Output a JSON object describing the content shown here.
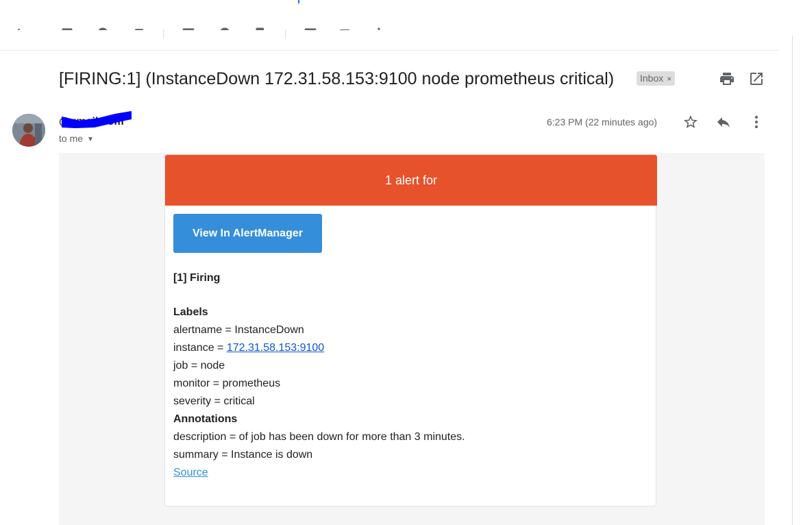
{
  "toolbar": {
    "icons": [
      "back-icon",
      "archive-icon",
      "report-spam-icon",
      "delete-icon",
      "mark-unread-icon",
      "snooze-icon",
      "add-task-icon",
      "move-to-icon",
      "labels-icon",
      "more-icon"
    ]
  },
  "subject": "[FIRING:1] (InstanceDown 172.31.58.153:9100 node prometheus critical)",
  "label_badge": {
    "text": "Inbox",
    "close": "×"
  },
  "header_icons": [
    "print-icon",
    "open-in-new-window-icon"
  ],
  "message": {
    "sender_email": "@gmail.com",
    "recipient": "to me",
    "timestamp": "6:23 PM (22 minutes ago)",
    "action_icons": [
      "star-icon",
      "reply-icon",
      "more-vert-icon"
    ]
  },
  "alert_email": {
    "banner": "1 alert for",
    "button": "View In AlertManager",
    "firing_header": "[1] Firing",
    "labels_header": "Labels",
    "labels": [
      {
        "prefix": "alertname = ",
        "value": "InstanceDown"
      },
      {
        "prefix": "instance = ",
        "value": "172.31.58.153:9100"
      },
      {
        "prefix": "job = ",
        "value": "node"
      },
      {
        "prefix": "monitor = ",
        "value": "prometheus"
      },
      {
        "prefix": "severity = ",
        "value": "critical"
      }
    ],
    "annotations_header": "Annotations",
    "annotations": [
      {
        "prefix": "description = ",
        "value": "of job has been down for more than 3 minutes."
      },
      {
        "prefix": "summary = ",
        "value": "Instance is down"
      }
    ],
    "source_link": "Source"
  },
  "colors": {
    "banner": "#e6522c",
    "button": "#348eda",
    "link": "#1155cc",
    "redaction": "#0000ff"
  }
}
